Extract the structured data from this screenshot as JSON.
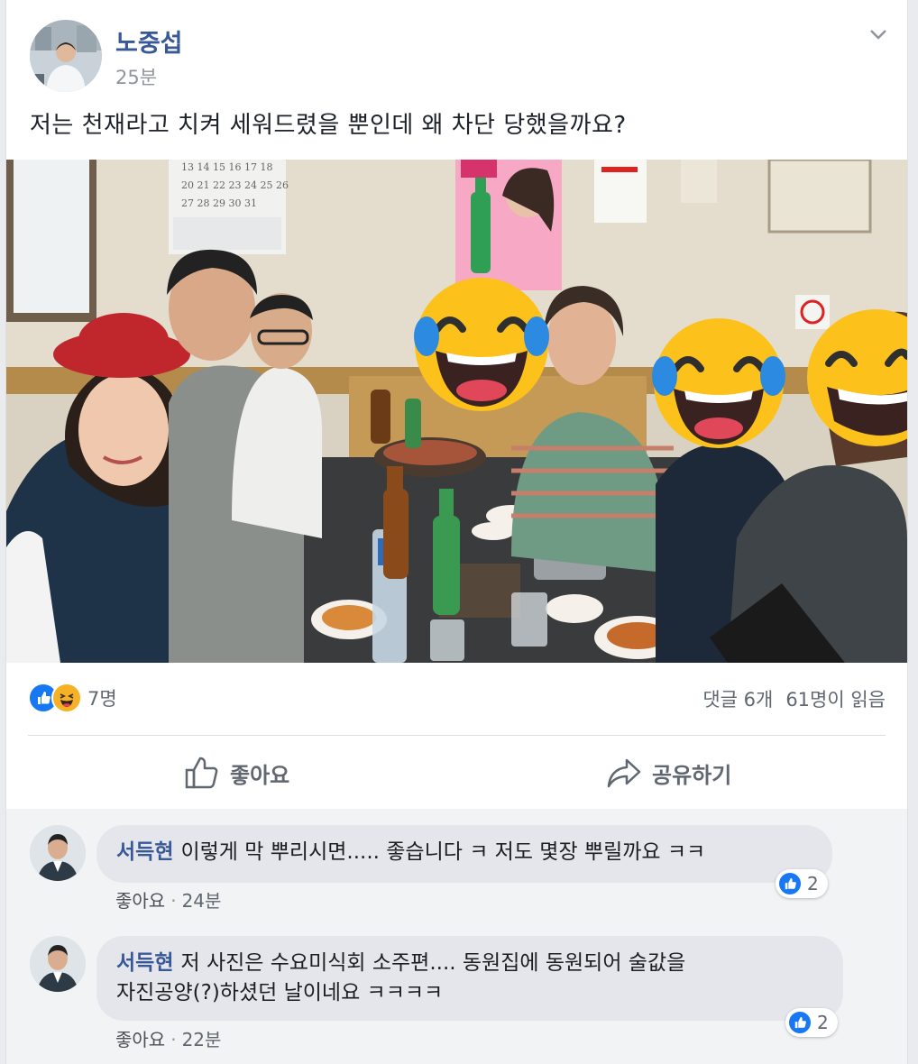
{
  "post": {
    "author": "노중섭",
    "time": "25분",
    "text": "저는 천재라고 치켜 세워드렸을 뿐인데 왜 차단 당했을까요?",
    "photo_icons": [
      "joy-emoji-icon",
      "joy-emoji-icon",
      "grinning-emoji-icon"
    ]
  },
  "reactions": {
    "icons": [
      "like-icon",
      "haha-icon"
    ],
    "count": "7명",
    "comments": "댓글 6개",
    "seen": "61명이 읽음"
  },
  "actions": {
    "like": "좋아요",
    "share": "공유하기"
  },
  "comments": [
    {
      "author": "서득현",
      "text": "이렇게 막 뿌리시면..... 좋습니다 ㅋ 저도 몇장 뿌릴까요 ㅋㅋ",
      "like": "좋아요",
      "time": "24분",
      "reaction_count": "2"
    },
    {
      "author": "서득현",
      "text_line1": "저 사진은 수요미식회 소주편.... 동원집에 동원되어 술값을",
      "text_line2": "자진공양(?)하셨던 날이네요 ㅋㅋㅋㅋ",
      "like": "좋아요",
      "time": "22분",
      "reaction_count": "2"
    }
  ],
  "colors": {
    "author": "#385898",
    "like_blue": "#1877f2",
    "haha_yellow": "#f7b125",
    "bubble": "#e4e6eb",
    "meta_gray": "#90949c"
  }
}
